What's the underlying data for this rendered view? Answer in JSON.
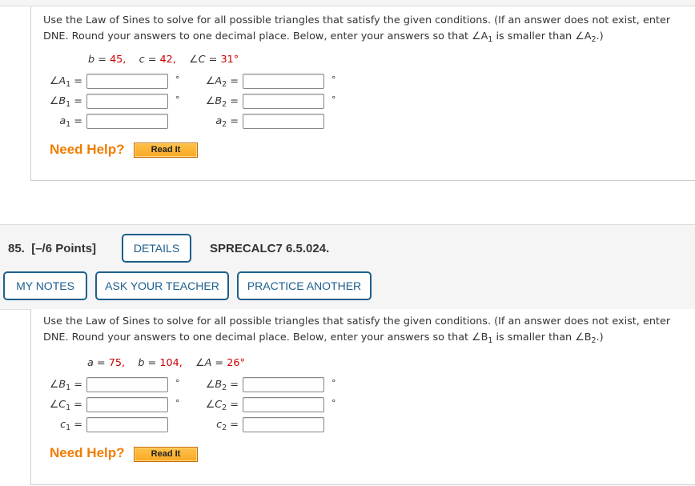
{
  "problem_prev": {
    "prompt_line1": "Use the Law of Sines to solve for all possible triangles that satisfy the given conditions. (If an answer does not exist, enter",
    "prompt_line2_pre": "DNE. Round your answers to one decimal place. Below, enter your answers so that ∠A",
    "prompt_line2_mid": " is smaller than ∠A",
    "prompt_line2_post": ".)",
    "sub1": "1",
    "sub2": "2",
    "given": [
      {
        "var": "b",
        "value": "45,"
      },
      {
        "var": "c",
        "value": "42,"
      },
      {
        "var": "∠C",
        "value": "31°"
      }
    ],
    "fields": [
      {
        "label": "∠A",
        "sub": "1",
        "unit": "°",
        "value": ""
      },
      {
        "label": "∠A",
        "sub": "2",
        "unit": "°",
        "value": ""
      },
      {
        "label": "∠B",
        "sub": "1",
        "unit": "°",
        "value": ""
      },
      {
        "label": "∠B",
        "sub": "2",
        "unit": "°",
        "value": ""
      },
      {
        "label": "a",
        "sub": "1",
        "unit": "",
        "value": ""
      },
      {
        "label": "a",
        "sub": "2",
        "unit": "",
        "value": ""
      }
    ],
    "need_help": "Need Help?",
    "read_it": "Read It"
  },
  "question": {
    "number": "85.",
    "points": "[–/6 Points]",
    "details_button": "DETAILS",
    "code": "SPRECALC7 6.5.024.",
    "my_notes_button": "MY NOTES",
    "ask_teacher_button": "ASK YOUR TEACHER",
    "practice_another_button": "PRACTICE ANOTHER"
  },
  "problem_current": {
    "prompt_line1": "Use the Law of Sines to solve for all possible triangles that satisfy the given conditions. (If an answer does not exist, enter",
    "prompt_line2_pre": "DNE. Round your answers to one decimal place. Below, enter your answers so that ∠B",
    "prompt_line2_mid": " is smaller than ∠B",
    "prompt_line2_post": ".)",
    "sub1": "1",
    "sub2": "2",
    "given": [
      {
        "var": "a",
        "value": "75,"
      },
      {
        "var": "b",
        "value": "104,"
      },
      {
        "var": "∠A",
        "value": "26°"
      }
    ],
    "fields": [
      {
        "label": "∠B",
        "sub": "1",
        "unit": "°",
        "value": ""
      },
      {
        "label": "∠B",
        "sub": "2",
        "unit": "°",
        "value": ""
      },
      {
        "label": "∠C",
        "sub": "1",
        "unit": "°",
        "value": ""
      },
      {
        "label": "∠C",
        "sub": "2",
        "unit": "°",
        "value": ""
      },
      {
        "label": "c",
        "sub": "1",
        "unit": "",
        "value": ""
      },
      {
        "label": "c",
        "sub": "2",
        "unit": "",
        "value": ""
      }
    ],
    "need_help": "Need Help?",
    "read_it": "Read It"
  },
  "colors": {
    "given_value": "#cc0000",
    "button_border": "#1d5f8c",
    "need_help": "#f07d00",
    "read_it_bg": "#f9a824"
  }
}
